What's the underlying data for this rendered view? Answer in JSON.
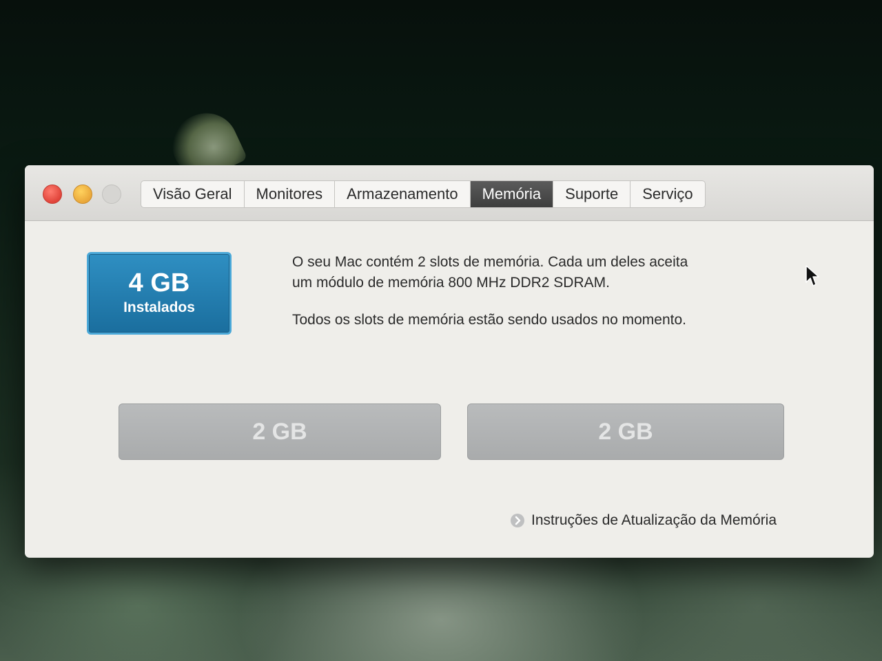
{
  "window": {
    "tabs": [
      {
        "label": "Visão Geral",
        "active": false
      },
      {
        "label": "Monitores",
        "active": false
      },
      {
        "label": "Armazenamento",
        "active": false
      },
      {
        "label": "Memória",
        "active": true
      },
      {
        "label": "Suporte",
        "active": false
      },
      {
        "label": "Serviço",
        "active": false
      }
    ]
  },
  "memory": {
    "installed_size": "4 GB",
    "installed_label": "Instalados",
    "description_line1": "O seu Mac contém 2 slots de memória. Cada um deles aceita",
    "description_line2": "um módulo de memória 800 MHz DDR2 SDRAM.",
    "note": "Todos os slots de memória estão sendo usados no momento.",
    "slots": [
      {
        "label": "2 GB"
      },
      {
        "label": "2 GB"
      }
    ],
    "upgrade_link": "Instruções de Atualização da Memória"
  },
  "colors": {
    "badge_blue": "#1a6e9e",
    "active_tab": "#3e3e3e",
    "slot_gray": "#a9abac"
  },
  "icons": {
    "close": "close-button",
    "minimize": "minimize-button",
    "zoom": "zoom-button",
    "link": "arrow-right-circle-icon",
    "cursor": "mouse-pointer-icon"
  }
}
